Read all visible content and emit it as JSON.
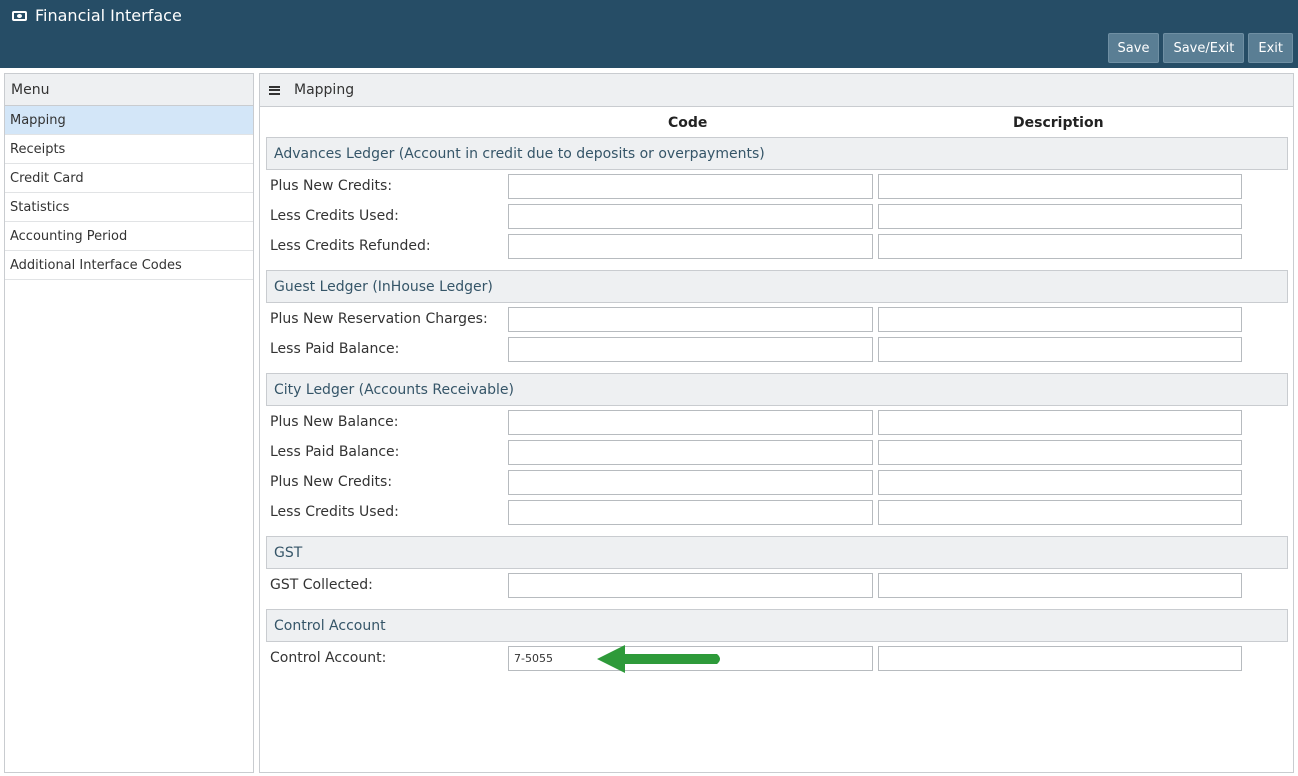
{
  "header": {
    "title": "Financial Interface",
    "buttons": {
      "save": "Save",
      "save_exit": "Save/Exit",
      "exit": "Exit"
    }
  },
  "sidebar": {
    "title": "Menu",
    "items": [
      {
        "label": "Mapping",
        "active": true
      },
      {
        "label": "Receipts"
      },
      {
        "label": "Credit Card"
      },
      {
        "label": "Statistics"
      },
      {
        "label": "Accounting Period"
      },
      {
        "label": "Additional Interface Codes"
      }
    ]
  },
  "main": {
    "title": "Mapping",
    "columns": {
      "code": "Code",
      "description": "Description"
    },
    "sections": [
      {
        "title": "Advances Ledger (Account in credit due to deposits or overpayments)",
        "rows": [
          {
            "label": "Plus New Credits:",
            "code": "",
            "description": ""
          },
          {
            "label": "Less Credits Used:",
            "code": "",
            "description": ""
          },
          {
            "label": "Less Credits Refunded:",
            "code": "",
            "description": ""
          }
        ]
      },
      {
        "title": "Guest Ledger (InHouse Ledger)",
        "rows": [
          {
            "label": "Plus New Reservation Charges:",
            "code": "",
            "description": ""
          },
          {
            "label": "Less Paid Balance:",
            "code": "",
            "description": ""
          }
        ]
      },
      {
        "title": "City Ledger (Accounts Receivable)",
        "rows": [
          {
            "label": "Plus New Balance:",
            "code": "",
            "description": ""
          },
          {
            "label": "Less Paid Balance:",
            "code": "",
            "description": ""
          },
          {
            "label": "Plus New Credits:",
            "code": "",
            "description": ""
          },
          {
            "label": "Less Credits Used:",
            "code": "",
            "description": ""
          }
        ]
      },
      {
        "title": "GST",
        "rows": [
          {
            "label": "GST Collected:",
            "code": "",
            "description": ""
          }
        ]
      },
      {
        "title": "Control Account",
        "rows": [
          {
            "label": "Control Account:",
            "code": "7-5055",
            "description": ""
          }
        ]
      }
    ]
  },
  "colors": {
    "topbar": "#264d66",
    "button": "#5a7e94",
    "active_menu": "#d3e6f8",
    "arrow": "#2e9a3a"
  }
}
